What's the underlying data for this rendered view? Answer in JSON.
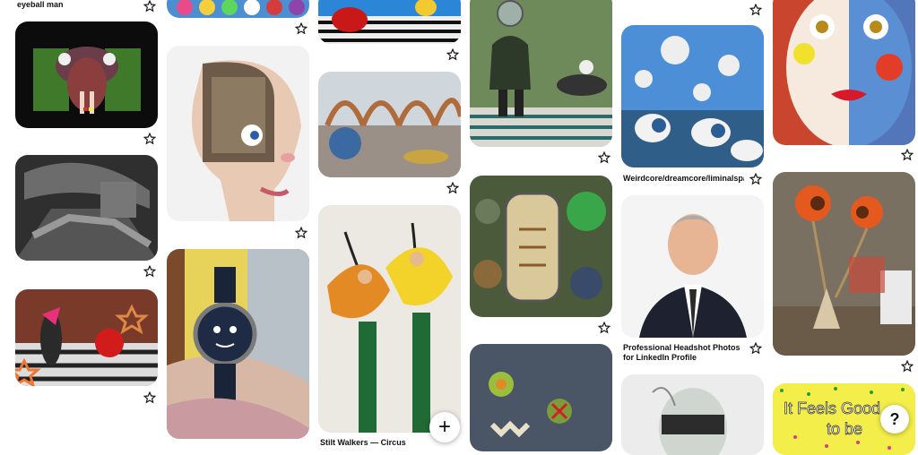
{
  "pins": [
    {
      "id": "c1p0",
      "caption": "eyeball man"
    },
    {
      "id": "c5p1",
      "caption": "Weirdcore/dreamcore/liminalspace"
    },
    {
      "id": "c5p2",
      "caption": "Professional Headshot Photos for LinkedIn Profile"
    },
    {
      "id": "c3p3",
      "caption": "Stilt Walkers — Circus"
    }
  ],
  "buttons": {
    "add_label": "+",
    "help_label": "?"
  },
  "overlay_text": {
    "bottom_right_line1": "It Feels Good",
    "bottom_right_line2": "to be"
  },
  "icons": {
    "save": "star-outline-icon",
    "add": "plus-icon",
    "help": "question-mark-icon"
  }
}
